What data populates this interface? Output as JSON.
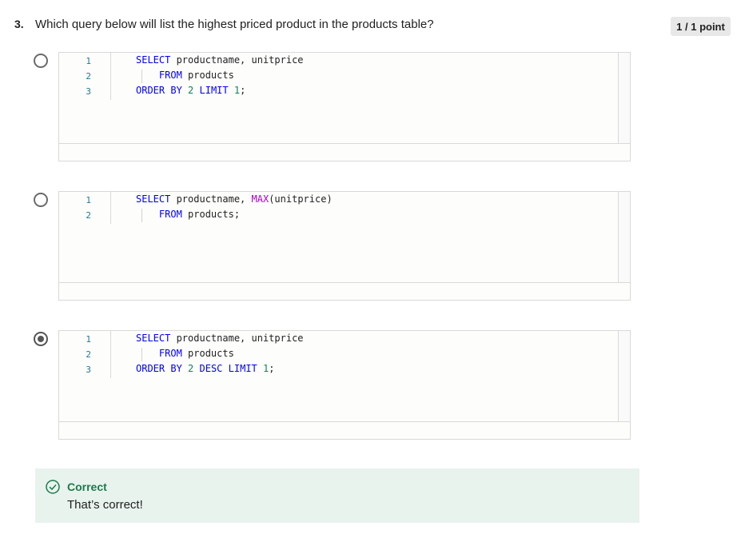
{
  "question": {
    "number": "3.",
    "text": "Which query below will list the highest priced product in the products table?",
    "score": "1 / 1 point"
  },
  "options": [
    {
      "selected": false,
      "line_numbers": [
        "1",
        "2",
        "3"
      ],
      "lines": [
        [
          {
            "t": "kw",
            "v": "SELECT"
          },
          {
            "t": "p",
            "v": " productname, unitprice"
          }
        ],
        [
          {
            "t": "p",
            "v": "    "
          },
          {
            "t": "kw",
            "v": "FROM"
          },
          {
            "t": "p",
            "v": " products"
          }
        ],
        [
          {
            "t": "kw",
            "v": "ORDER BY"
          },
          {
            "t": "p",
            "v": " "
          },
          {
            "t": "num",
            "v": "2"
          },
          {
            "t": "p",
            "v": " "
          },
          {
            "t": "kw",
            "v": "LIMIT"
          },
          {
            "t": "p",
            "v": " "
          },
          {
            "t": "num",
            "v": "1"
          },
          {
            "t": "p",
            "v": ";"
          }
        ]
      ]
    },
    {
      "selected": false,
      "line_numbers": [
        "1",
        "2"
      ],
      "lines": [
        [
          {
            "t": "kw",
            "v": "SELECT"
          },
          {
            "t": "p",
            "v": " productname, "
          },
          {
            "t": "fn",
            "v": "MAX"
          },
          {
            "t": "p",
            "v": "(unitprice)"
          }
        ],
        [
          {
            "t": "p",
            "v": "    "
          },
          {
            "t": "kw",
            "v": "FROM"
          },
          {
            "t": "p",
            "v": " products;"
          }
        ]
      ]
    },
    {
      "selected": true,
      "line_numbers": [
        "1",
        "2",
        "3"
      ],
      "lines": [
        [
          {
            "t": "kw",
            "v": "SELECT"
          },
          {
            "t": "p",
            "v": " productname, unitprice"
          }
        ],
        [
          {
            "t": "p",
            "v": "    "
          },
          {
            "t": "kw",
            "v": "FROM"
          },
          {
            "t": "p",
            "v": " products"
          }
        ],
        [
          {
            "t": "kw",
            "v": "ORDER BY"
          },
          {
            "t": "p",
            "v": " "
          },
          {
            "t": "num",
            "v": "2"
          },
          {
            "t": "p",
            "v": " "
          },
          {
            "t": "kw",
            "v": "DESC"
          },
          {
            "t": "p",
            "v": " "
          },
          {
            "t": "kw",
            "v": "LIMIT"
          },
          {
            "t": "p",
            "v": " "
          },
          {
            "t": "num",
            "v": "1"
          },
          {
            "t": "p",
            "v": ";"
          }
        ]
      ]
    }
  ],
  "feedback": {
    "title": "Correct",
    "text": "That’s correct!",
    "icon": "check-circle-icon",
    "color": "#1d7a4a",
    "background": "#e8f3ee"
  }
}
